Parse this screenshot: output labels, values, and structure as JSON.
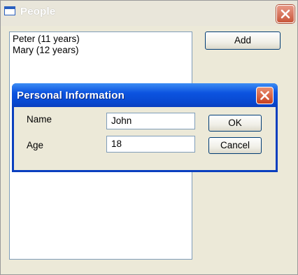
{
  "window": {
    "title": "People",
    "close_label": "Close"
  },
  "people_list": {
    "items": [
      "Peter (11 years)",
      "Mary (12 years)"
    ]
  },
  "toolbar": {
    "add_label": "Add"
  },
  "dialog": {
    "title": "Personal Information",
    "name_label": "Name",
    "name_value": "John",
    "age_label": "Age",
    "age_value": "18",
    "ok_label": "OK",
    "cancel_label": "Cancel"
  },
  "colors": {
    "dialog_title_bar": "#0c54e0",
    "window_background": "#ece9d8",
    "close_button": "#c8563a"
  }
}
